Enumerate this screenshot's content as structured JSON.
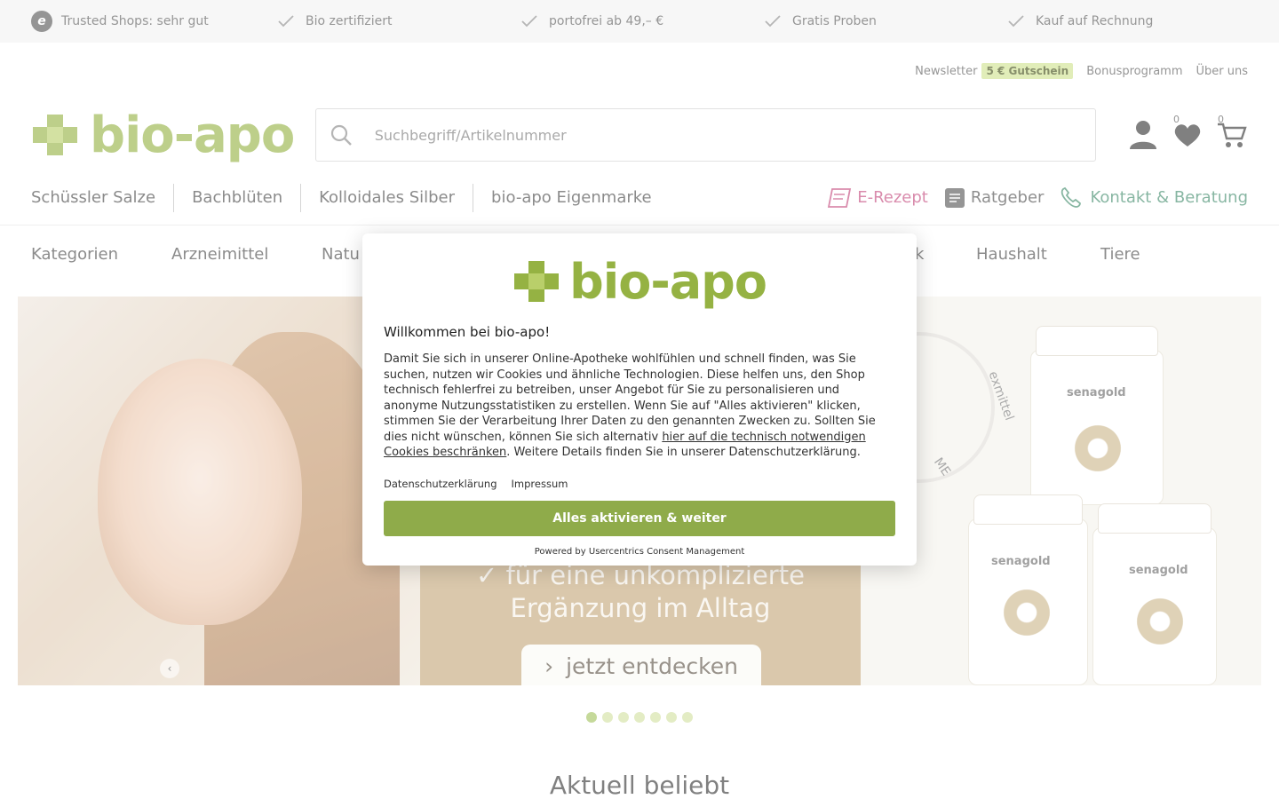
{
  "trustbar": {
    "items": [
      {
        "label": "Trusted Shops: sehr gut",
        "icon": "trusted-shops-icon"
      },
      {
        "label": "Bio zertifiziert",
        "icon": "check-icon"
      },
      {
        "label": "portofrei ab 49,– €",
        "icon": "check-icon"
      },
      {
        "label": "Gratis Proben",
        "icon": "check-icon"
      },
      {
        "label": "Kauf auf Rechnung",
        "icon": "check-icon"
      }
    ]
  },
  "meta": {
    "newsletter": "Newsletter",
    "voucher_badge": "5 € Gutschein",
    "bonus": "Bonusprogramm",
    "about": "Über uns"
  },
  "header": {
    "logo_text": "bio-apo",
    "search_placeholder": "Suchbegriff/Artikelnummer",
    "wishlist_count": "0",
    "cart_count": "0"
  },
  "nav_primary": {
    "left": [
      "Schüssler Salze",
      "Bachblüten",
      "Kolloidales Silber",
      "bio-apo Eigenmarke"
    ],
    "erezept": "E-Rezept",
    "ratgeber": "Ratgeber",
    "kontakt": "Kontakt & Beratung"
  },
  "nav_secondary": {
    "items": [
      "Kategorien",
      "Arzneimittel",
      "Natu",
      "k",
      "Haushalt",
      "Tiere"
    ]
  },
  "hero": {
    "tagline_1": "✓ für eine unkomplizierte",
    "tagline_2": "Ergänzung im Alltag",
    "cta_label": "jetzt entdecken",
    "seal_text": "exmittel",
    "seal_text_2": "ME",
    "jar_brand": "senagold",
    "dots_total": 7,
    "dots_active": 1
  },
  "section": {
    "title": "Aktuell beliebt"
  },
  "consent": {
    "logo_text": "bio-apo",
    "heading": "Willkommen bei bio-apo!",
    "body_1": "Damit Sie sich in unserer Online-Apotheke wohlfühlen und schnell finden, was Sie suchen, nutzen wir Cookies und ähnliche Technologien. Diese helfen uns, den Shop technisch fehlerfrei zu betreiben, unser Angebot für Sie zu personalisieren und anonyme Nutzungsstatistiken zu erstellen. Wenn Sie auf \"Alles aktivieren\" klicken, stimmen Sie der Verarbeitung Ihrer Daten zu den genannten Zwecken zu. Sollten Sie dies nicht wünschen, können Sie sich alternativ ",
    "body_link": "hier auf die technisch notwendigen Cookies beschränken",
    "body_2": ". Weitere Details finden Sie in unserer Datenschutzerklärung.",
    "link_privacy": "Datenschutzerklärung",
    "link_imprint": "Impressum",
    "accept_label": "Alles aktivieren & weiter",
    "powered_by": "Powered by Usercentrics Consent Management"
  },
  "colors": {
    "brand_green": "#95b243",
    "button_green": "#8fab4a",
    "erezept_pink": "#c2457a",
    "kontakt_green": "#3e8a6a"
  }
}
